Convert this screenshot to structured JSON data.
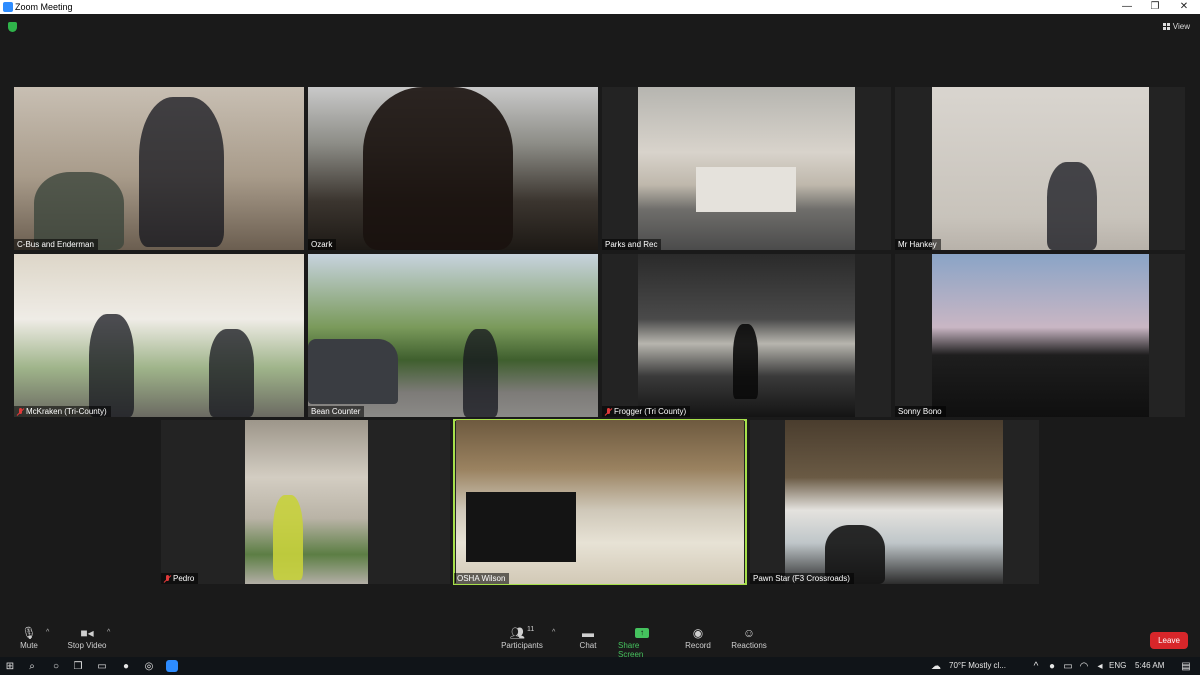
{
  "window": {
    "title": "Zoom Meeting",
    "minimize": "—",
    "restore": "❐",
    "close": "✕"
  },
  "header": {
    "view_label": "View"
  },
  "participants": [
    {
      "name": "C-Bus and Enderman",
      "muted": false
    },
    {
      "name": "Ozark",
      "muted": false
    },
    {
      "name": "Parks and Rec",
      "muted": false
    },
    {
      "name": "Mr Hankey",
      "muted": false
    },
    {
      "name": "McKraken (Tri-County)",
      "muted": true
    },
    {
      "name": "Bean Counter",
      "muted": false
    },
    {
      "name": "Frogger (Tri County)",
      "muted": true
    },
    {
      "name": "Sonny Bono",
      "muted": false
    },
    {
      "name": "Pedro",
      "muted": true
    },
    {
      "name": "OSHA Wilson",
      "muted": false,
      "active_speaker": true
    },
    {
      "name": "Pawn Star (F3 Crossroads)",
      "muted": false
    }
  ],
  "toolbar": {
    "mute": "Mute",
    "stop_video": "Stop Video",
    "participants": "Participants",
    "participants_count": "11",
    "chat": "Chat",
    "share_screen": "Share Screen",
    "record": "Record",
    "reactions": "Reactions",
    "leave": "Leave"
  },
  "taskbar": {
    "weather": "70°F  Mostly cl...",
    "language": "ENG",
    "time": "5:46 AM"
  },
  "colors": {
    "share_green": "#45c25e",
    "leave_red": "#d7262a",
    "active_outline": "#a7e04b"
  }
}
